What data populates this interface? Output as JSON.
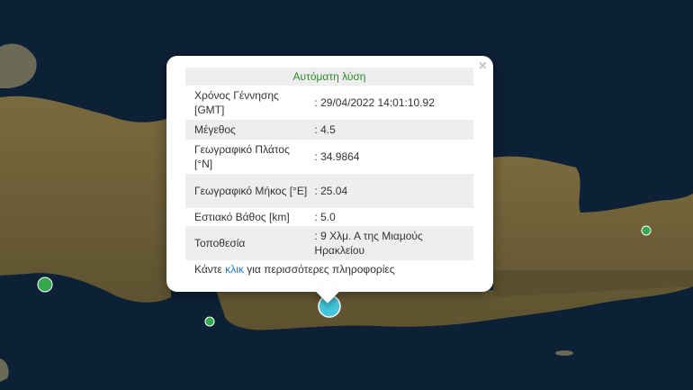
{
  "popup": {
    "title": "Αυτόματη λύση",
    "close_glyph": "×",
    "rows": [
      {
        "label": "Χρόνος Γέννησης [GMT]",
        "value": ": 29/04/2022 14:01:10.92"
      },
      {
        "label": "Μέγεθος",
        "value": ": 4.5"
      },
      {
        "label": "Γεωγραφικό Πλάτος [°N]",
        "value": ": 34.9864"
      },
      {
        "label": "Γεωγραφικό Μήκος [°E]",
        "value": ": 25.04"
      },
      {
        "label": "Εστιακό Βάθος [km]",
        "value": ": 5.0"
      },
      {
        "label": "Τοποθεσία",
        "value": ": 9 Χλμ. Α της Μιαμούς Ηρακλείου"
      }
    ],
    "more_prefix": "Κάντε ",
    "more_link": "κλικ",
    "more_suffix": " για περισσότερες πληροφορίες"
  },
  "colors": {
    "sea": "#0c2036",
    "land": "#6b5b34",
    "marker_main": "#43c6db",
    "marker_other": "#33a84f",
    "title_green": "#2d8a2d",
    "link": "#1a7fc8"
  }
}
